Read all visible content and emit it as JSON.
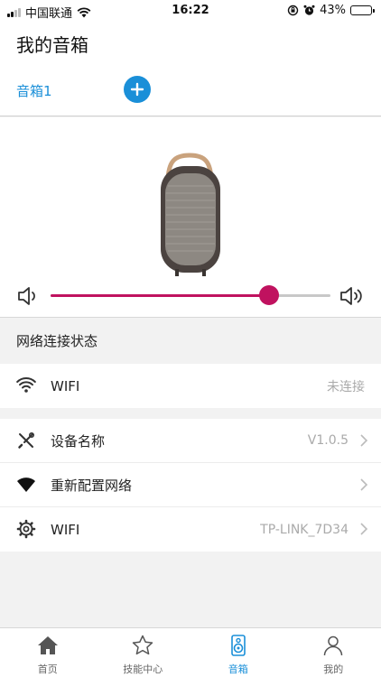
{
  "status_bar": {
    "carrier": "中国联通",
    "time": "16:22",
    "battery": "43%",
    "battery_level": 0.43
  },
  "header": {
    "title": "我的音箱",
    "device_tab": "音箱1",
    "add_icon": "plus-icon"
  },
  "speaker": {
    "volume_level": 0.78
  },
  "network": {
    "section_title": "网络连接状态",
    "wifi_label": "WIFI",
    "wifi_status": "未连接"
  },
  "settings": {
    "items": [
      {
        "label": "设备名称",
        "value": "V1.0.5",
        "icon": "tools-icon"
      },
      {
        "label": "重新配置网络",
        "value": "",
        "icon": "wifi-solid-icon"
      },
      {
        "label": "WIFI",
        "value": "TP-LINK_7D34",
        "icon": "gear-icon"
      }
    ]
  },
  "tab_bar": {
    "tabs": [
      {
        "label": "首页",
        "icon": "home-icon"
      },
      {
        "label": "技能中心",
        "icon": "star-icon"
      },
      {
        "label": "音箱",
        "icon": "speaker-icon"
      },
      {
        "label": "我的",
        "icon": "user-icon"
      }
    ],
    "active": "音箱"
  },
  "colors": {
    "accent": "#1a8fd8",
    "slider": "#c0125f"
  }
}
